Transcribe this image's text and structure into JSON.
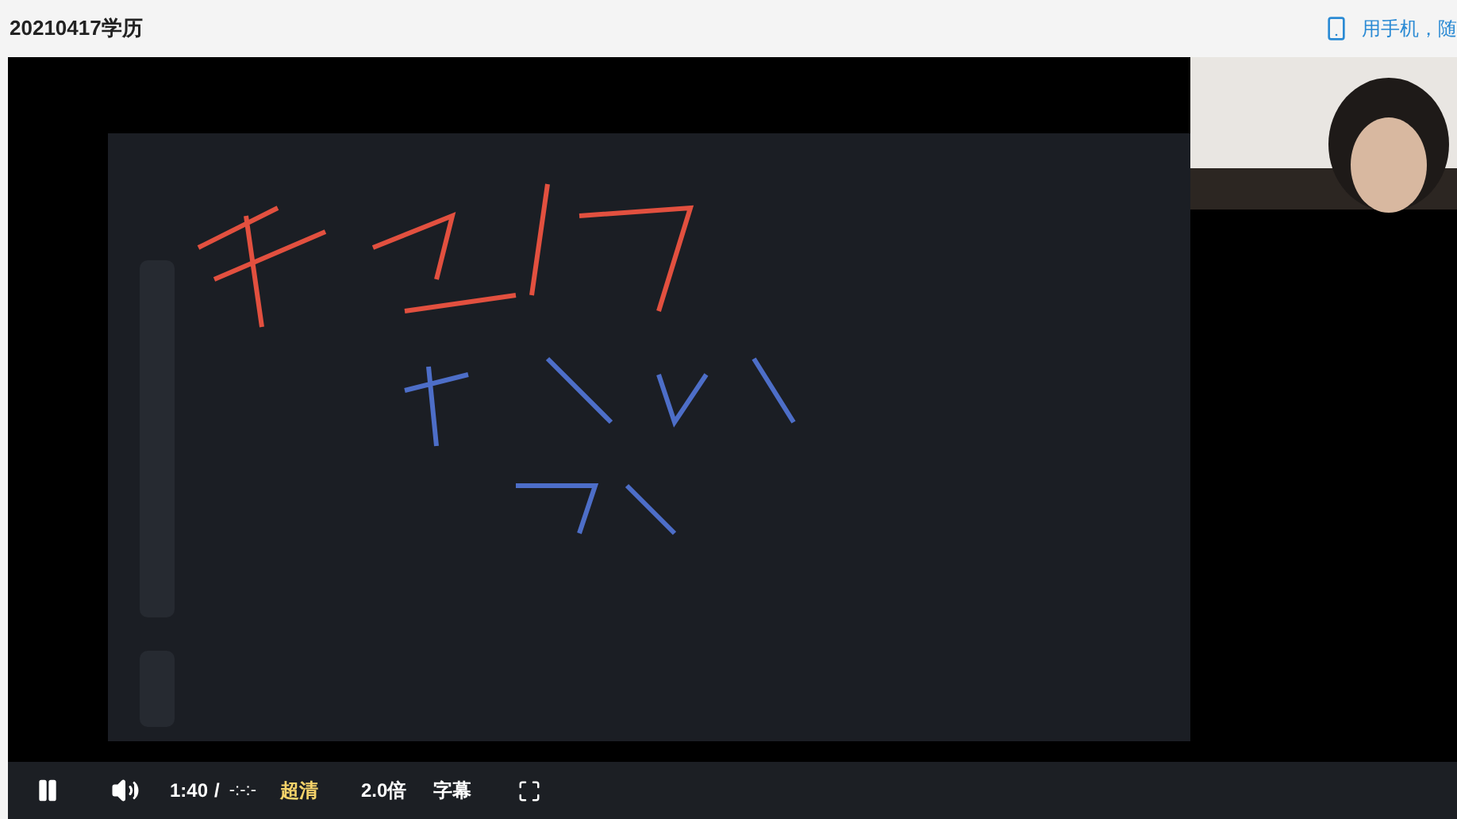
{
  "page": {
    "title": "20210417学历",
    "mobile_link": "用手机，随"
  },
  "player": {
    "playing": true,
    "muted": false,
    "current_time": "1:40",
    "separator": "/",
    "duration": "-:-:-",
    "quality": "超清",
    "speed": "2.0倍",
    "subtitles": "字幕"
  }
}
